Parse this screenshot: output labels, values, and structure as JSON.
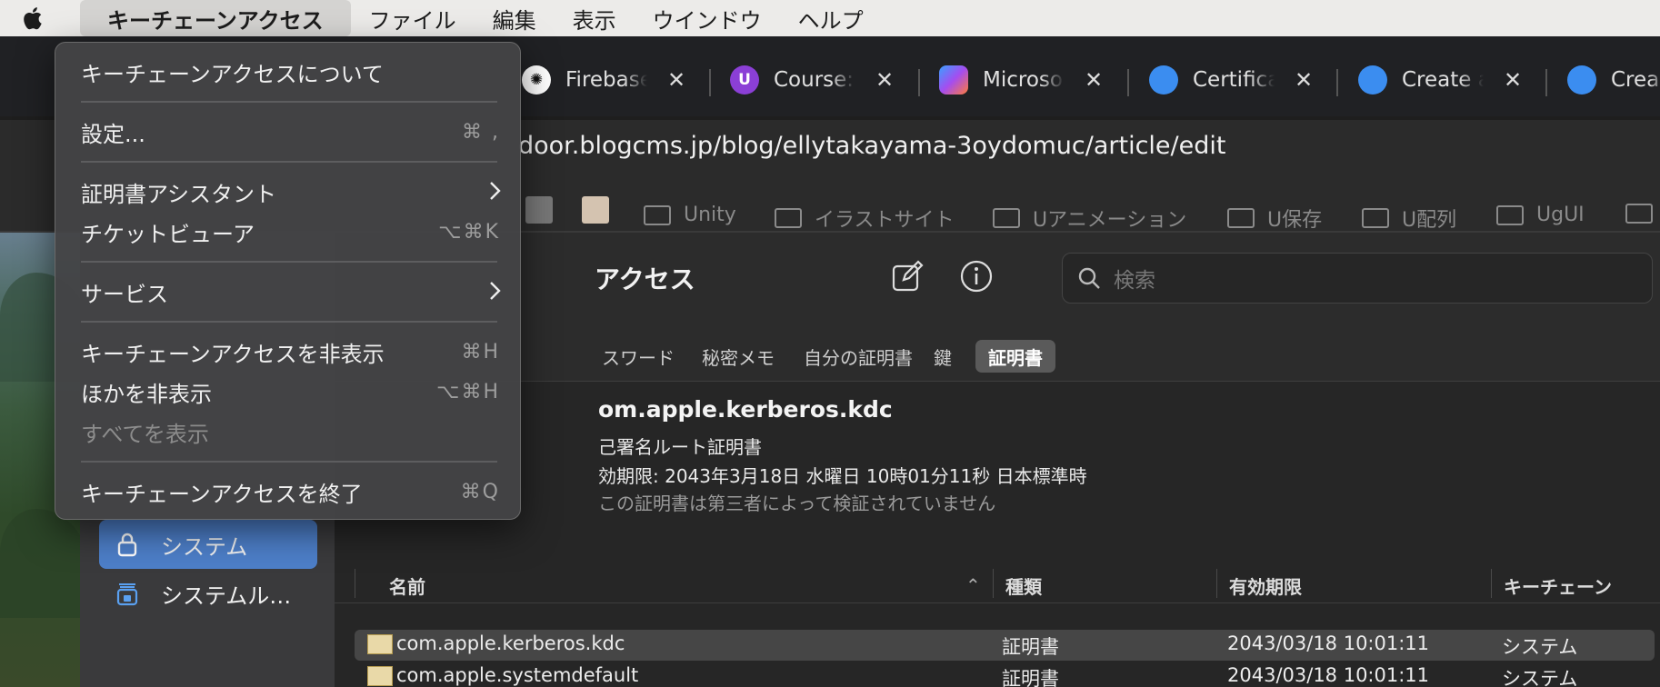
{
  "menubar": {
    "app_menu": "キーチェーンアクセス",
    "items": [
      "ファイル",
      "編集",
      "表示",
      "ウインドウ",
      "ヘルプ"
    ]
  },
  "browser": {
    "tabs": [
      {
        "title": "Firebase",
        "icon": "openai-icon"
      },
      {
        "title": "Course:",
        "icon": "udemy-icon"
      },
      {
        "title": "Microso",
        "icon": "copilot-icon"
      },
      {
        "title": "Certifica",
        "icon": "apple-icon"
      },
      {
        "title": "Create a",
        "icon": "apple-icon"
      },
      {
        "title": "Crea",
        "icon": "apple-icon"
      }
    ],
    "url": "door.blogcms.jp/blog/ellytakayama-3oydomuc/article/edit",
    "bookmarks": [
      "Unity",
      "イラストサイト",
      "Uアニメーション",
      "U保存",
      "U配列",
      "UgUI"
    ]
  },
  "keychain": {
    "title": "アクセス",
    "search_placeholder": "検索",
    "tabs": [
      "スワード",
      "秘密メモ",
      "自分の証明書",
      "鍵",
      "証明書"
    ],
    "selected_tab": "証明書",
    "sidebar": [
      {
        "label": "システム",
        "selected": true
      },
      {
        "label": "システムル…",
        "selected": false
      }
    ],
    "detail": {
      "name": "om.apple.kerberos.kdc",
      "kind": "己署名ルート証明書",
      "expires": "効期限: 2043年3月18日 水曜日 10時01分11秒 日本標準時",
      "warning": "この証明書は第三者によって検証されていません"
    },
    "columns": {
      "name": "名前",
      "kind": "種類",
      "expires": "有効期限",
      "keychain": "キーチェーン"
    },
    "rows": [
      {
        "name": "com.apple.kerberos.kdc",
        "kind": "証明書",
        "expires": "2043/03/18 10:01:11",
        "keychain": "システム"
      },
      {
        "name": "com.apple.systemdefault",
        "kind": "証明書",
        "expires": "2043/03/18 10:01:11",
        "keychain": "システム"
      }
    ]
  },
  "menu": {
    "about": "キーチェーンアクセスについて",
    "settings": "設定...",
    "settings_sc": "⌘ ,",
    "cert_assistant": "証明書アシスタント",
    "ticket_viewer": "チケットビューア",
    "ticket_viewer_sc": "⌥⌘K",
    "services": "サービス",
    "hide": "キーチェーンアクセスを非表示",
    "hide_sc": "⌘H",
    "hide_others": "ほかを非表示",
    "hide_others_sc": "⌥⌘H",
    "show_all": "すべてを表示",
    "quit": "キーチェーンアクセスを終了",
    "quit_sc": "⌘Q"
  },
  "colors": {
    "accent": "#4d7fc9",
    "menubar_bg": "#ecebe9"
  }
}
